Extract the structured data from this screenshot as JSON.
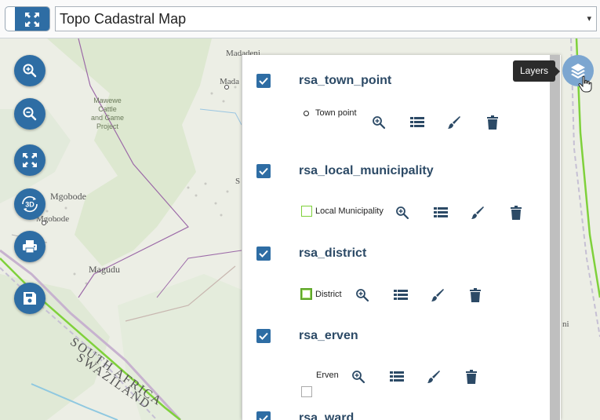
{
  "header": {
    "map_select_value": "Topo Cadastral Map",
    "dropdown_arrow": "▾"
  },
  "map": {
    "places": [
      {
        "name": "Madadeni",
        "label": "Madadeni"
      },
      {
        "name": "Mada",
        "label": "Mada"
      },
      {
        "name": "Mgobode-upper",
        "label": "Mgobode"
      },
      {
        "name": "Mgobode-lower",
        "label": "Mgobode"
      },
      {
        "name": "Magudu",
        "label": "Magudu"
      },
      {
        "name": "S",
        "label": "S"
      },
      {
        "name": "ni",
        "label": "ni"
      }
    ],
    "park_label": [
      "Mawewe",
      "Cattle",
      "and Game",
      "Project"
    ],
    "border_labels": {
      "south_africa": "SOUTH AFRICA",
      "swaziland": "SWAZILAND"
    }
  },
  "tools": [
    {
      "name": "zoom-in",
      "icon": "zoom-in-icon"
    },
    {
      "name": "zoom-out",
      "icon": "zoom-out-icon"
    },
    {
      "name": "full-extent",
      "icon": "expand-arrows-icon"
    },
    {
      "name": "3d-view",
      "icon": "rotate-3d-icon",
      "label": "3D"
    },
    {
      "name": "print",
      "icon": "printer-icon"
    },
    {
      "name": "save",
      "icon": "save-icon"
    }
  ],
  "layers_button": {
    "tooltip": "Layers",
    "icon": "layers-icon"
  },
  "layers": [
    {
      "id": "rsa_town_point",
      "checked": true,
      "legend_symbol": "point",
      "legend_label": "Town point"
    },
    {
      "id": "rsa_local_municipality",
      "checked": true,
      "legend_symbol": "square-green",
      "legend_label": "Local Municipality"
    },
    {
      "id": "rsa_district",
      "checked": true,
      "legend_symbol": "square-green-bold",
      "legend_label": "District"
    },
    {
      "id": "rsa_erven",
      "checked": true,
      "legend_symbol": "square-grey",
      "legend_label": "Erven"
    },
    {
      "id": "rsa_ward",
      "checked": true
    }
  ],
  "colors": {
    "accent": "#2e6da4",
    "layer_title": "#2c4a66",
    "legend_green": "#7fd13b",
    "layers_button": "#7ca6d0"
  }
}
